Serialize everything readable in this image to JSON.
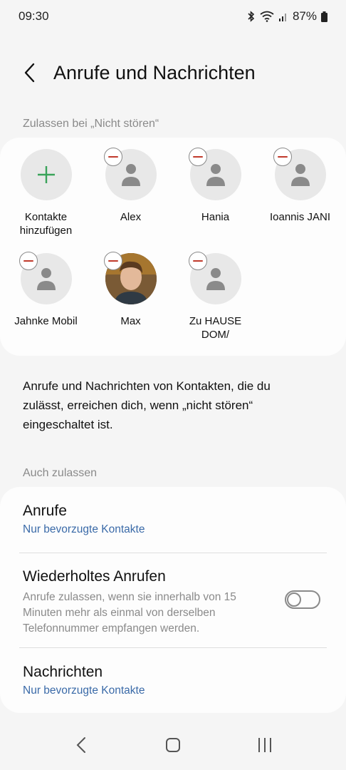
{
  "status": {
    "time": "09:30",
    "battery": "87%"
  },
  "header": {
    "title": "Anrufe und Nachrichten"
  },
  "allow_section": {
    "header": "Zulassen bei „Nicht stören“",
    "add_label_1": "Kontakte",
    "add_label_2": "hinzufügen",
    "contacts": [
      {
        "line1": "Alex",
        "line2": ""
      },
      {
        "line1": "Hania",
        "line2": ""
      },
      {
        "line1": "Ioannis JANI",
        "line2": ""
      },
      {
        "line1": "Jahnke Mobil",
        "line2": ""
      },
      {
        "line1": "Max",
        "line2": ""
      },
      {
        "line1": "Zu HAUSE",
        "line2": "DOM/"
      }
    ]
  },
  "info": {
    "text": "Anrufe und Nachrichten von Kontakten, die du zulässt, erreichen dich, wenn „nicht stören“ eingeschaltet ist."
  },
  "also_allow": {
    "header": "Auch zulassen",
    "calls": {
      "title": "Anrufe",
      "value": "Nur bevorzugte Kontakte"
    },
    "repeat": {
      "title": "Wiederholtes Anrufen",
      "desc": "Anrufe zulassen, wenn sie innerhalb von 15 Minuten mehr als einmal von derselben Telefonnummer empfangen werden.",
      "enabled": false
    },
    "messages": {
      "title": "Nachrichten",
      "value": "Nur bevorzugte Kontakte"
    }
  },
  "colors": {
    "accent_link": "#3a6aa8",
    "add_plus": "#3aa35a",
    "remove_minus": "#c0392b"
  }
}
